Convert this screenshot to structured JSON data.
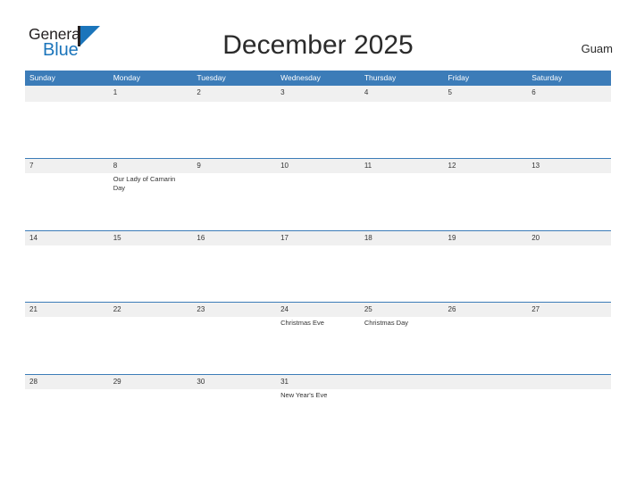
{
  "brand": {
    "name_part1": "General",
    "name_part2": "Blue",
    "accent_color": "#1b75bb",
    "dark_color": "#231f20",
    "logo_icon": "triangle-flag-icon"
  },
  "header": {
    "title": "December 2025",
    "region": "Guam"
  },
  "calendar": {
    "header_color": "#3c7cb8",
    "date_band_color": "#f0f0f0",
    "weekdays": [
      "Sunday",
      "Monday",
      "Tuesday",
      "Wednesday",
      "Thursday",
      "Friday",
      "Saturday"
    ],
    "weeks": [
      {
        "days": [
          {
            "date": "",
            "event": ""
          },
          {
            "date": "1",
            "event": ""
          },
          {
            "date": "2",
            "event": ""
          },
          {
            "date": "3",
            "event": ""
          },
          {
            "date": "4",
            "event": ""
          },
          {
            "date": "5",
            "event": ""
          },
          {
            "date": "6",
            "event": ""
          }
        ]
      },
      {
        "days": [
          {
            "date": "7",
            "event": ""
          },
          {
            "date": "8",
            "event": "Our Lady of Camarin Day"
          },
          {
            "date": "9",
            "event": ""
          },
          {
            "date": "10",
            "event": ""
          },
          {
            "date": "11",
            "event": ""
          },
          {
            "date": "12",
            "event": ""
          },
          {
            "date": "13",
            "event": ""
          }
        ]
      },
      {
        "days": [
          {
            "date": "14",
            "event": ""
          },
          {
            "date": "15",
            "event": ""
          },
          {
            "date": "16",
            "event": ""
          },
          {
            "date": "17",
            "event": ""
          },
          {
            "date": "18",
            "event": ""
          },
          {
            "date": "19",
            "event": ""
          },
          {
            "date": "20",
            "event": ""
          }
        ]
      },
      {
        "days": [
          {
            "date": "21",
            "event": ""
          },
          {
            "date": "22",
            "event": ""
          },
          {
            "date": "23",
            "event": ""
          },
          {
            "date": "24",
            "event": "Christmas Eve"
          },
          {
            "date": "25",
            "event": "Christmas Day"
          },
          {
            "date": "26",
            "event": ""
          },
          {
            "date": "27",
            "event": ""
          }
        ]
      },
      {
        "days": [
          {
            "date": "28",
            "event": ""
          },
          {
            "date": "29",
            "event": ""
          },
          {
            "date": "30",
            "event": ""
          },
          {
            "date": "31",
            "event": "New Year's Eve"
          },
          {
            "date": "",
            "event": ""
          },
          {
            "date": "",
            "event": ""
          },
          {
            "date": "",
            "event": ""
          }
        ]
      }
    ]
  }
}
